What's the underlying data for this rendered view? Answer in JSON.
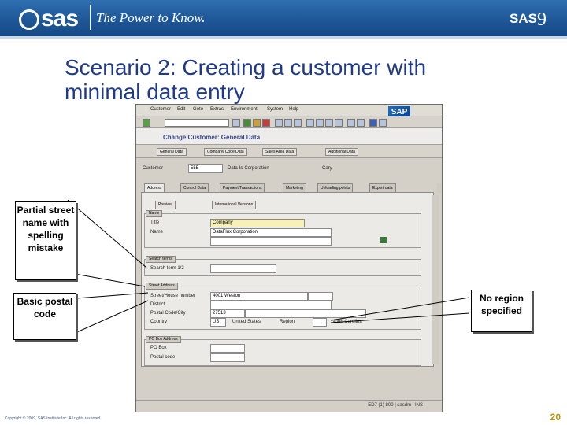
{
  "header": {
    "logo_text": "sas",
    "tagline": "The Power to Know.",
    "brand": "SAS",
    "brand_version": "9"
  },
  "slide": {
    "title": "Scenario 2: Creating a customer with minimal data entry",
    "page_number": "20",
    "copyright": "Copyright © 2009, SAS Institute Inc. All rights reserved."
  },
  "callouts": {
    "partial_street": "Partial street name with spelling mistake",
    "basic_postal": "Basic postal code",
    "no_region": "No region specified"
  },
  "sap": {
    "logo": "SAP",
    "menu": [
      "Customer",
      "Edit",
      "Goto",
      "Extras",
      "Environment",
      "System",
      "Help"
    ],
    "screen_title": "Change Customer: General Data",
    "app_buttons": [
      "General Data",
      "Company Code Data",
      "Sales Area Data",
      "Additional Data"
    ],
    "customer_label": "Customer",
    "customer_value": "555",
    "customer_name": "Data-Is-Corporation",
    "city_short": "Cary",
    "tabs": [
      "Address",
      "Control Data",
      "Payment Transactions",
      "Marketing",
      "Unloading points",
      "Export data"
    ],
    "preview_btn": "Preview",
    "intl_btn": "International Versions",
    "name_group": "Name",
    "title_label": "Title",
    "title_value": "Company",
    "name_label": "Name",
    "name_value": "DataFlux Corporation",
    "search_group": "Search terms",
    "search_label": "Search term 1/2",
    "street_group": "Street Address",
    "street_label": "Street/House number",
    "street_value": "4001 Weston",
    "district_label": "District",
    "postal_label": "Postal Code/City",
    "postal_value": "27513",
    "country_label": "Country",
    "country_code": "US",
    "country_name": "United States",
    "region_label": "Region",
    "region_value": "North Carolina",
    "pobox_group": "PO Box Address",
    "pobox_label": "PO Box",
    "postal2_label": "Postal code",
    "status_text": "ED7 (1) 800  |  sasdm  |  INS"
  }
}
